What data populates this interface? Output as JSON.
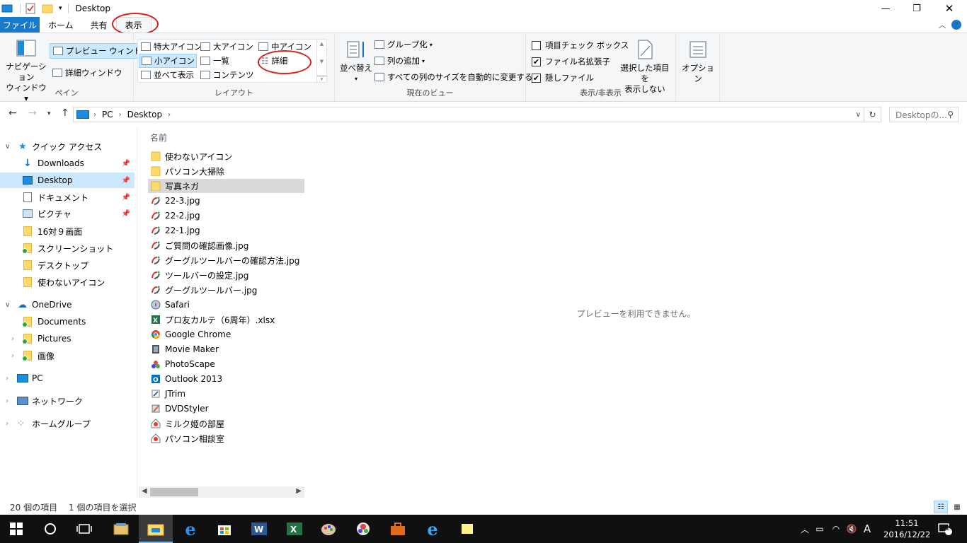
{
  "window": {
    "title": "Desktop"
  },
  "tabs": [
    "ファイル",
    "ホーム",
    "共有",
    "表示"
  ],
  "ribbon": {
    "pane": {
      "nav_pane_line1": "ナビゲーション",
      "nav_pane_line2": "ウィンドウ",
      "preview": "プレビュー ウィンドウ",
      "details": "詳細ウィンドウ",
      "label": "ペイン"
    },
    "layout": {
      "extra_large": "特大アイコン",
      "large": "大アイコン",
      "medium": "中アイコン",
      "small": "小アイコン",
      "list": "一覧",
      "details": "詳細",
      "tiles": "並べて表示",
      "content": "コンテンツ",
      "label": "レイアウト"
    },
    "current_view": {
      "sort": "並べ替え",
      "group": "グループ化",
      "add_column": "列の追加",
      "autosize": "すべての列のサイズを自動的に変更する",
      "label": "現在のビュー"
    },
    "show_hide": {
      "checkboxes": "項目チェック ボックス",
      "extensions": "ファイル名拡張子",
      "hidden": "隠しファイル",
      "hide_selected_line1": "選択した項目を",
      "hide_selected_line2": "表示しない",
      "label": "表示/非表示"
    },
    "options": "オプション"
  },
  "address": {
    "crumbs": [
      "PC",
      "Desktop"
    ],
    "search_placeholder": "Desktopの..."
  },
  "nav": {
    "quick_access": "クイック アクセス",
    "downloads": "Downloads",
    "desktop": "Desktop",
    "documents_jp": "ドキュメント",
    "pictures_jp": "ピクチャ",
    "f16x9": "16対９画面",
    "screenshots": "スクリーンショット",
    "desktop_jp": "デスクトップ",
    "unused_icons": "使わないアイコン",
    "onedrive": "OneDrive",
    "od_documents": "Documents",
    "od_pictures": "Pictures",
    "od_images": "画像",
    "pc": "PC",
    "network": "ネットワーク",
    "homegroup": "ホームグループ"
  },
  "list": {
    "column_name": "名前",
    "files": [
      {
        "name": "使わないアイコン",
        "icon": "folder-icon"
      },
      {
        "name": "パソコン大掃除",
        "icon": "folder-icon"
      },
      {
        "name": "写真ネガ",
        "icon": "folder-icon"
      },
      {
        "name": "22-3.jpg",
        "icon": "image-file-icon"
      },
      {
        "name": "22-2.jpg",
        "icon": "image-file-icon"
      },
      {
        "name": "22-1.jpg",
        "icon": "image-file-icon"
      },
      {
        "name": "ご質問の確認画像.jpg",
        "icon": "image-file-icon"
      },
      {
        "name": "グーグルツールバーの確認方法.jpg",
        "icon": "image-file-icon"
      },
      {
        "name": "ツールバーの設定.jpg",
        "icon": "image-file-icon"
      },
      {
        "name": "グーグルツールバー.jpg",
        "icon": "image-file-icon"
      },
      {
        "name": "Safari",
        "icon": "safari-shortcut-icon"
      },
      {
        "name": "プロ友カルテ（6周年）.xlsx",
        "icon": "excel-file-icon"
      },
      {
        "name": "Google Chrome",
        "icon": "chrome-shortcut-icon"
      },
      {
        "name": "Movie Maker",
        "icon": "movie-maker-shortcut-icon"
      },
      {
        "name": "PhotoScape",
        "icon": "photoscape-shortcut-icon"
      },
      {
        "name": "Outlook 2013",
        "icon": "outlook-shortcut-icon"
      },
      {
        "name": "JTrim",
        "icon": "jtrim-shortcut-icon"
      },
      {
        "name": "DVDStyler",
        "icon": "dvdstyler-shortcut-icon"
      },
      {
        "name": "ミルク姫の部屋",
        "icon": "web-shortcut-icon"
      },
      {
        "name": "パソコン相談室",
        "icon": "web-shortcut-icon"
      }
    ]
  },
  "preview": {
    "message": "プレビューを利用できません。"
  },
  "status": {
    "count": "20 個の項目",
    "selected": "1 個の項目を選択"
  },
  "taskbar": {
    "time": "11:51",
    "date": "2016/12/22",
    "ime": "A",
    "notifications": "2"
  },
  "colors": {
    "accent": "#1979ca",
    "selection": "#cce8ff",
    "selected_row": "#d9d9d9",
    "annotation": "#d91e1e"
  }
}
